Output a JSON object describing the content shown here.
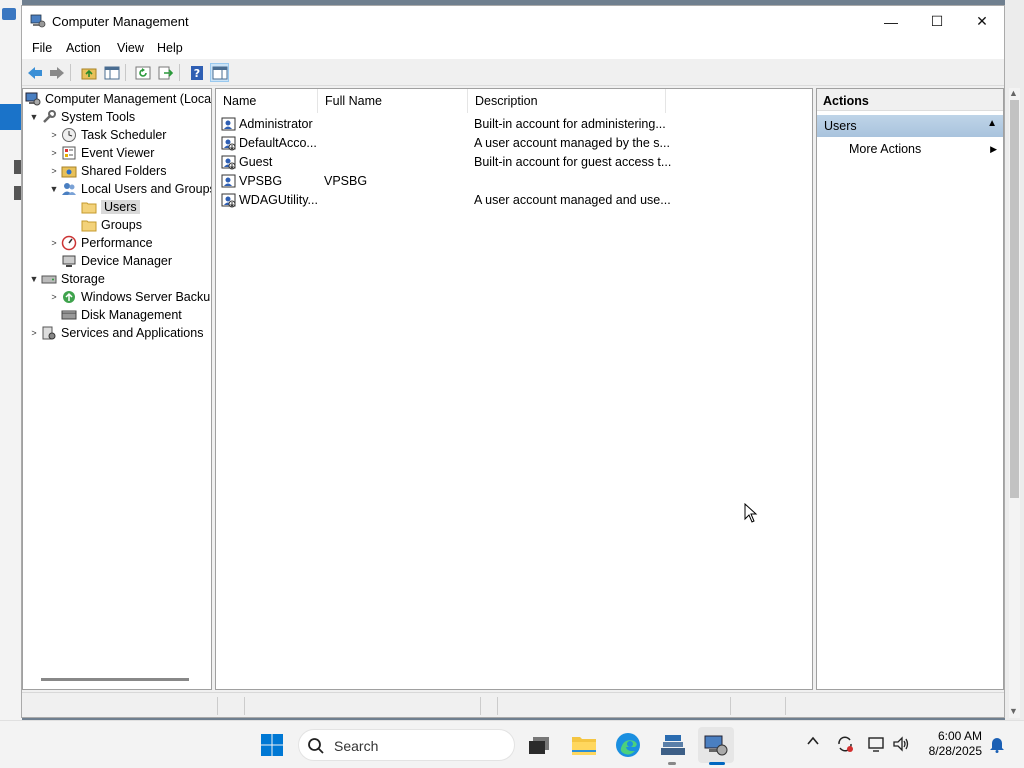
{
  "window": {
    "title": "Computer Management",
    "minimize": "—",
    "maximize": "☐",
    "close": "✕"
  },
  "menu": [
    "File",
    "Action",
    "View",
    "Help"
  ],
  "tree": [
    {
      "label": "Computer Management (Local",
      "twisty": "",
      "icon": "computer-management-icon"
    },
    {
      "label": "System Tools",
      "twisty": "▼",
      "icon": "system-tools-icon"
    },
    {
      "label": "Task Scheduler",
      "twisty": ">",
      "icon": "clock-icon"
    },
    {
      "label": "Event Viewer",
      "twisty": ">",
      "icon": "event-viewer-icon"
    },
    {
      "label": "Shared Folders",
      "twisty": ">",
      "icon": "shared-folder-icon"
    },
    {
      "label": "Local Users and Groups",
      "twisty": "▼",
      "icon": "users-groups-icon"
    },
    {
      "label": "Users",
      "twisty": "",
      "icon": "folder-icon"
    },
    {
      "label": "Groups",
      "twisty": "",
      "icon": "folder-icon"
    },
    {
      "label": "Performance",
      "twisty": ">",
      "icon": "performance-icon"
    },
    {
      "label": "Device Manager",
      "twisty": "",
      "icon": "device-manager-icon"
    },
    {
      "label": "Storage",
      "twisty": "▼",
      "icon": "storage-icon"
    },
    {
      "label": "Windows Server Backup",
      "twisty": ">",
      "icon": "backup-icon"
    },
    {
      "label": "Disk Management",
      "twisty": "",
      "icon": "disk-icon"
    },
    {
      "label": "Services and Applications",
      "twisty": ">",
      "icon": "services-icon"
    }
  ],
  "list": {
    "columns": [
      "Name",
      "Full Name",
      "Description"
    ],
    "rows": [
      {
        "name": "Administrator",
        "full_name": "",
        "description": "Built-in account for administering..."
      },
      {
        "name": "DefaultAcco...",
        "full_name": "",
        "description": "A user account managed by the s..."
      },
      {
        "name": "Guest",
        "full_name": "",
        "description": "Built-in account for guest access t..."
      },
      {
        "name": "VPSBG",
        "full_name": "VPSBG",
        "description": ""
      },
      {
        "name": "WDAGUtility...",
        "full_name": "",
        "description": "A user account managed and use..."
      }
    ]
  },
  "actions": {
    "header": "Actions",
    "section": "Users",
    "section_arrow": "▲",
    "more_actions": "More Actions",
    "more_arrow": "▶"
  },
  "taskbar": {
    "search_placeholder": "Search",
    "time": "6:00 AM",
    "date": "8/28/2025",
    "tray_chevron": "^"
  },
  "colors": {
    "accent": "#0067c0",
    "selection": "#d9d9d9",
    "actions_section": "#b4cbe2"
  }
}
